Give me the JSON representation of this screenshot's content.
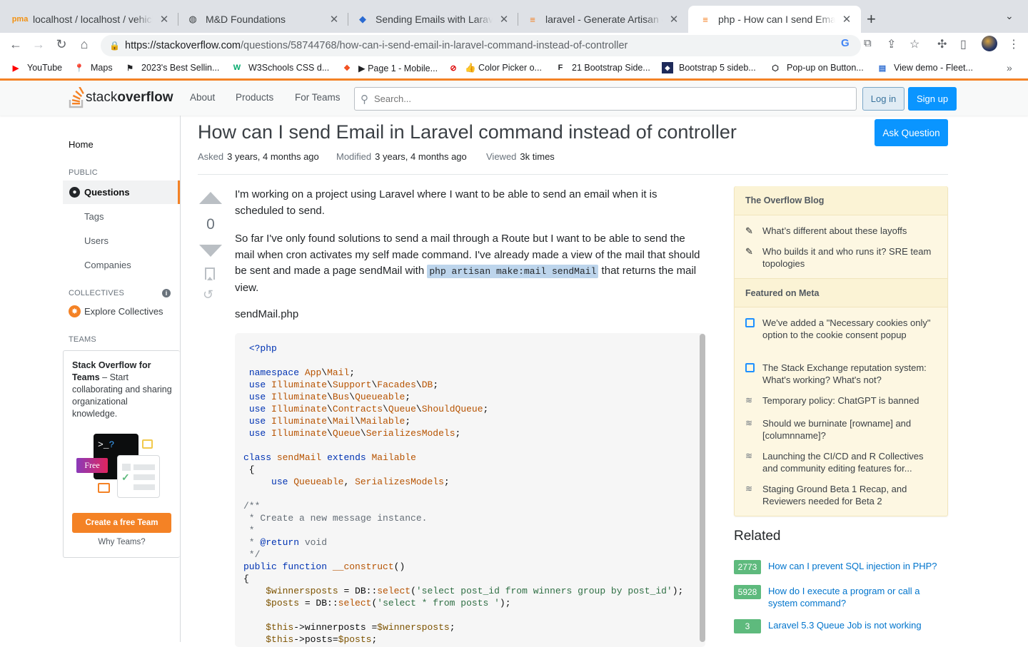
{
  "browser": {
    "tabs": [
      {
        "title": "localhost / localhost / vehicle /",
        "icon": "phpmyadmin-icon"
      },
      {
        "title": "M&D Foundations",
        "icon": "globe-icon"
      },
      {
        "title": "Sending Emails with Laravel: A",
        "icon": "code-icon"
      },
      {
        "title": "laravel - Generate Artisan com",
        "icon": "stackoverflow-icon"
      },
      {
        "title": "php - How can I send Email in L",
        "icon": "stackoverflow-icon"
      }
    ],
    "url_host": "https://stackoverflow.com",
    "url_path": "/questions/58744768/how-can-i-send-email-in-laravel-command-instead-of-controller",
    "bookmarks": [
      {
        "label": "YouTube"
      },
      {
        "label": "Maps"
      },
      {
        "label": "2023's Best Sellin..."
      },
      {
        "label": "W3Schools CSS d..."
      },
      {
        "label": "▶ Page 1 - Mobile..."
      },
      {
        "label": "👍 Color Picker o..."
      },
      {
        "label": "21 Bootstrap Side..."
      },
      {
        "label": "Bootstrap 5 sideb..."
      },
      {
        "label": "Pop-up on Button..."
      },
      {
        "label": "View demo - Fleet..."
      }
    ]
  },
  "header": {
    "logo_stack": "stack",
    "logo_overflow": "overflow",
    "nav": [
      "About",
      "Products",
      "For Teams"
    ],
    "search_placeholder": "Search...",
    "login": "Log in",
    "signup": "Sign up"
  },
  "sidebar": {
    "home": "Home",
    "public": "PUBLIC",
    "questions": "Questions",
    "tags": "Tags",
    "users": "Users",
    "companies": "Companies",
    "collectives": "COLLECTIVES",
    "explore": "Explore Collectives",
    "teams": "TEAMS",
    "teams_title": "Stack Overflow for Teams",
    "teams_text": " – Start collaborating and sharing organizational knowledge.",
    "free_badge": "Free",
    "create_team": "Create a free Team",
    "why_teams": "Why Teams?"
  },
  "question": {
    "title": "How can I send Email in Laravel command instead of controller",
    "ask_button": "Ask Question",
    "asked_label": "Asked",
    "asked_value": "3 years, 4 months ago",
    "modified_label": "Modified",
    "modified_value": "3 years, 4 months ago",
    "viewed_label": "Viewed",
    "viewed_value": "3k times",
    "votes": "0",
    "para1": "I'm working on a project using Laravel where I want to be able to send an email when it is scheduled to send.",
    "para2a": "So far I've only found solutions to send a mail through a Route but I want to be able to send the mail when cron activates my self made command. I've already made a view of the mail that should be sent and made a page sendMail with ",
    "para2code": "php artisan make:mail sendMail",
    "para2b": " that returns the mail view.",
    "filename": "sendMail.php"
  },
  "blog": {
    "heading": "The Overflow Blog",
    "items": [
      "What’s different about these layoffs",
      "Who builds it and who runs it? SRE team topologies"
    ],
    "meta_heading": "Featured on Meta",
    "meta_items": [
      "We've added a \"Necessary cookies only\" option to the cookie consent popup",
      "The Stack Exchange reputation system: What's working? What's not?",
      "Temporary policy: ChatGPT is banned",
      "Should we burninate [rowname] and [columnname]?",
      "Launching the CI/CD and R Collectives and community editing features for...",
      "Staging Ground Beta 1 Recap, and Reviewers needed for Beta 2"
    ]
  },
  "related": {
    "heading": "Related",
    "items": [
      {
        "score": "2773",
        "title": "How can I prevent SQL injection in PHP?"
      },
      {
        "score": "5928",
        "title": "How do I execute a program or call a system command?"
      },
      {
        "score": "3",
        "title": "Laravel 5.3 Queue Job is not working"
      }
    ]
  },
  "colors": {
    "accent": "#f48225",
    "primary": "#0a95ff",
    "answered": "#5eba7d"
  }
}
